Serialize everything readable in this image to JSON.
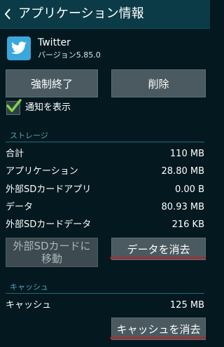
{
  "header": {
    "title": "アプリケーション情報"
  },
  "app": {
    "name": "Twitter",
    "version": "バージョン5.85.0"
  },
  "actions": {
    "force_stop": "強制終了",
    "uninstall": "削除"
  },
  "notifications": {
    "label": "通知を表示",
    "checked": true
  },
  "storage": {
    "section_title": "ストレージ",
    "rows": [
      {
        "label": "合計",
        "value": "110 MB"
      },
      {
        "label": "アプリケーション",
        "value": "28.80 MB"
      },
      {
        "label": "外部SDカードアプリ",
        "value": "0.00 B"
      },
      {
        "label": "データ",
        "value": "80.93 MB"
      },
      {
        "label": "外部SDカードデータ",
        "value": "216 KB"
      }
    ],
    "move_button_line1": "外部SDカードに",
    "move_button_line2": "移動",
    "clear_data_button": "データを消去"
  },
  "cache": {
    "section_title": "キャッシュ",
    "label": "キャッシュ",
    "value": "125 MB",
    "clear_cache_button": "キャッシュを消去"
  },
  "colors": {
    "background": "#03191f",
    "header": "#0b3b47",
    "section_title": "#5aa2b7",
    "button": "#4a5a60",
    "underline": "#d11a1a",
    "checkmark": "#7fd34a",
    "twitter_blue": "#3aa7dd"
  },
  "icons": {
    "back": "chevron-left-icon",
    "app": "twitter-bird-icon",
    "check": "checkmark-icon"
  }
}
